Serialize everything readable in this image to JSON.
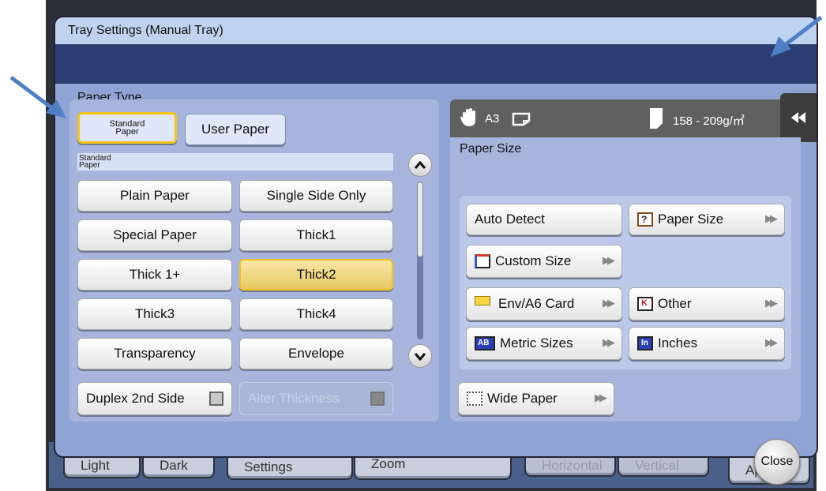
{
  "background": {
    "buttons": [
      "Light",
      "Dark",
      "Settings",
      "Zoom",
      "Horizontal",
      "Vertical",
      "Ap"
    ]
  },
  "dialog": {
    "title": "Tray Settings (Manual Tray)",
    "close_label": "Close"
  },
  "paper_type": {
    "label": "Paper Type",
    "tabs": [
      "Standard Paper",
      "User Paper"
    ],
    "section_label": "Standard Paper",
    "buttons": [
      "Plain Paper",
      "Single Side Only",
      "Special Paper",
      "Thick1",
      "Thick 1+",
      "Thick2",
      "Thick3",
      "Thick4",
      "Transparency",
      "Envelope"
    ],
    "selected": "Thick2",
    "duplex_label": "Duplex 2nd Side",
    "alter_thickness_label": "Alter Thickness"
  },
  "info_bar": {
    "size": "A3",
    "weight": "158 - 209g/㎡"
  },
  "paper_size": {
    "label": "Paper Size",
    "auto_detect": "Auto Detect",
    "paper_size": "Paper Size",
    "custom_size": "Custom Size",
    "env_card": "Env/A6 Card",
    "other": "Other",
    "metric": "Metric Sizes",
    "inches": "Inches",
    "wide_paper": "Wide Paper"
  },
  "colors": {
    "accent": "#f3c51b",
    "annotation_arrow": "#4f7fc4"
  }
}
